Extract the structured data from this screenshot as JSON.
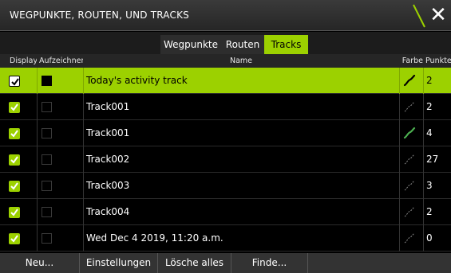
{
  "window": {
    "title": "WEGPUNKTE, ROUTEN, UND TRACKS"
  },
  "tabs": [
    {
      "label": "Wegpunkte",
      "active": false
    },
    {
      "label": "Routen",
      "active": false
    },
    {
      "label": "Tracks",
      "active": true
    }
  ],
  "columns": {
    "display": "Display",
    "record": "Aufzeichnen",
    "name": "Name",
    "color": "Farbe",
    "points": "Punkte"
  },
  "rows": [
    {
      "name": "Today's activity track",
      "display": true,
      "record": true,
      "color_icon": "track-color-icon-black",
      "points": "2",
      "selected": true
    },
    {
      "name": "Track001",
      "display": true,
      "record": false,
      "color_icon": "track-color-icon-gray",
      "points": "2"
    },
    {
      "name": "Track001",
      "display": true,
      "record": false,
      "color_icon": "track-color-icon-green",
      "points": "4"
    },
    {
      "name": "Track002",
      "display": true,
      "record": false,
      "color_icon": "track-color-icon-gray",
      "points": "27"
    },
    {
      "name": "Track003",
      "display": true,
      "record": false,
      "color_icon": "track-color-icon-gray",
      "points": "3"
    },
    {
      "name": "Track004",
      "display": true,
      "record": false,
      "color_icon": "track-color-icon-gray",
      "points": "2"
    },
    {
      "name": "Wed Dec 4 2019, 11:20 a.m.",
      "display": true,
      "record": false,
      "color_icon": "track-color-icon-gray",
      "points": "0"
    }
  ],
  "buttons": {
    "new": "Neu...",
    "settings": "Einstellungen",
    "delete_all": "Lösche alles",
    "find": "Finde..."
  },
  "colors": {
    "accent": "#9cd100",
    "background": "#000000",
    "track_green": "#4caf50",
    "track_gray": "#8a8a8a"
  }
}
